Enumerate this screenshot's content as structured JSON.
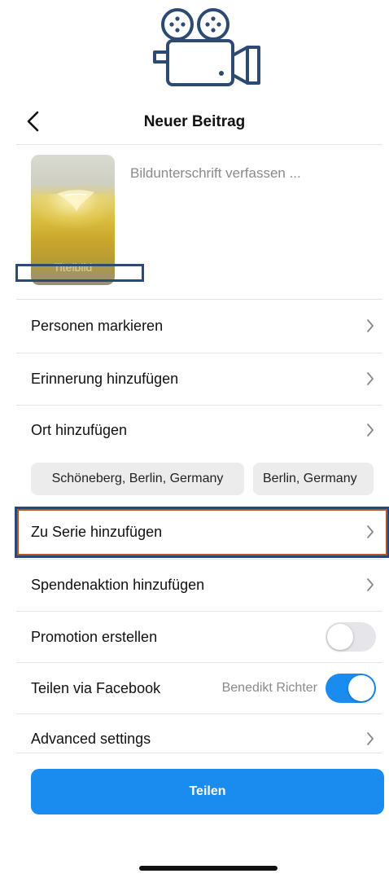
{
  "header": {
    "title": "Neuer Beitrag",
    "back_icon": "chevron-left-icon"
  },
  "post": {
    "thumbnail_label": "Titelbild",
    "caption_placeholder": "Bildunterschrift verfassen ..."
  },
  "rows": {
    "tag_people": "Personen markieren",
    "add_reminder": "Erinnerung hinzufügen",
    "add_location": "Ort hinzufügen",
    "add_to_series": "Zu Serie hinzufügen",
    "add_fundraiser": "Spendenaktion hinzufügen",
    "create_promotion": "Promotion erstellen",
    "share_facebook": "Teilen via Facebook",
    "advanced_settings": "Advanced settings"
  },
  "location_suggestions": [
    "Schöneberg, Berlin, Germany",
    "Berlin, Germany"
  ],
  "facebook": {
    "account_name": "Benedikt Richter",
    "enabled": true
  },
  "promotion": {
    "enabled": false
  },
  "share_button": {
    "label": "Teilen"
  },
  "colors": {
    "accent": "#1a8cf0",
    "highlight_outer": "#2a4877",
    "highlight_inner": "#b6571f"
  }
}
